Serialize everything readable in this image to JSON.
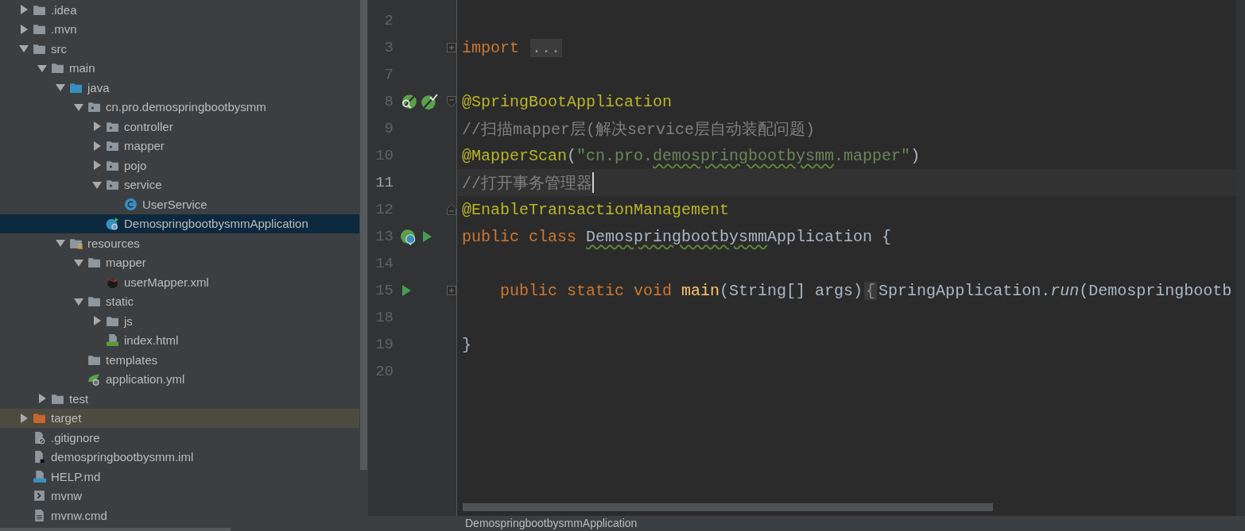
{
  "project_tree": [
    {
      "label": ".idea",
      "kind": "folder",
      "expanded": false,
      "selected": false,
      "highlighted": false
    },
    {
      "label": ".mvn",
      "kind": "folder",
      "expanded": false,
      "selected": false,
      "highlighted": false
    },
    {
      "label": "src",
      "kind": "folder",
      "expanded": true,
      "selected": false,
      "highlighted": false,
      "children": [
        {
          "label": "main",
          "kind": "folder",
          "expanded": true,
          "selected": false,
          "highlighted": false,
          "children": [
            {
              "label": "java",
              "kind": "sources",
              "expanded": true,
              "selected": false,
              "highlighted": false,
              "children": [
                {
                  "label": "cn.pro.demospringbootbysmm",
                  "kind": "package",
                  "expanded": true,
                  "selected": false,
                  "highlighted": false,
                  "children": [
                    {
                      "label": "controller",
                      "kind": "package",
                      "expanded": false,
                      "selected": false,
                      "highlighted": false
                    },
                    {
                      "label": "mapper",
                      "kind": "package",
                      "expanded": false,
                      "selected": false,
                      "highlighted": false
                    },
                    {
                      "label": "pojo",
                      "kind": "package",
                      "expanded": false,
                      "selected": false,
                      "highlighted": false
                    },
                    {
                      "label": "service",
                      "kind": "package",
                      "expanded": true,
                      "selected": false,
                      "highlighted": false,
                      "children": [
                        {
                          "label": "UserService",
                          "kind": "class",
                          "selected": false,
                          "highlighted": false
                        }
                      ]
                    },
                    {
                      "label": "DemospringbootbysmmApplication",
                      "kind": "application",
                      "selected": true,
                      "highlighted": false
                    }
                  ]
                }
              ]
            },
            {
              "label": "resources",
              "kind": "resources",
              "expanded": true,
              "selected": false,
              "highlighted": false,
              "children": [
                {
                  "label": "mapper",
                  "kind": "folder",
                  "expanded": true,
                  "selected": false,
                  "highlighted": false,
                  "children": [
                    {
                      "label": "userMapper.xml",
                      "kind": "mapping",
                      "selected": false,
                      "highlighted": false
                    }
                  ]
                },
                {
                  "label": "static",
                  "kind": "folder",
                  "expanded": true,
                  "selected": false,
                  "highlighted": false,
                  "children": [
                    {
                      "label": "js",
                      "kind": "folder",
                      "expanded": false,
                      "selected": false,
                      "highlighted": false
                    },
                    {
                      "label": "index.html",
                      "kind": "html",
                      "selected": false,
                      "highlighted": false
                    }
                  ]
                },
                {
                  "label": "templates",
                  "kind": "folder",
                  "selected": false,
                  "highlighted": false
                },
                {
                  "label": "application.yml",
                  "kind": "config",
                  "selected": false,
                  "highlighted": false
                }
              ]
            }
          ]
        },
        {
          "label": "test",
          "kind": "folder",
          "expanded": false,
          "selected": false,
          "highlighted": false
        }
      ]
    },
    {
      "label": "target",
      "kind": "excluded",
      "expanded": false,
      "selected": false,
      "highlighted": true
    },
    {
      "label": ".gitignore",
      "kind": "ignore",
      "selected": false,
      "highlighted": false
    },
    {
      "label": "demospringbootbysmm.iml",
      "kind": "module",
      "selected": false,
      "highlighted": false
    },
    {
      "label": "HELP.md",
      "kind": "markdown",
      "selected": false,
      "highlighted": false
    },
    {
      "label": "mvnw",
      "kind": "script",
      "selected": false,
      "highlighted": false
    },
    {
      "label": "mvnw.cmd",
      "kind": "text",
      "selected": false,
      "highlighted": false
    }
  ],
  "editor": {
    "lines": [
      {
        "number": "2",
        "kind": "plain",
        "current": false
      },
      {
        "number": "3",
        "kind": "imports",
        "current": false,
        "tokens": [
          {
            "kind": "keyword",
            "text": "import "
          },
          {
            "kind": "folded",
            "text": "..."
          }
        ]
      },
      {
        "number": "7",
        "kind": "plain",
        "current": false
      },
      {
        "number": "8",
        "kind": "springapp",
        "current": false,
        "tokens": [
          {
            "kind": "annotation",
            "text": "@SpringBootApplication"
          }
        ]
      },
      {
        "number": "9",
        "kind": "plain",
        "current": false,
        "tokens": [
          {
            "kind": "comment",
            "text": "//扫描mapper层(解决service层自动装配问题)"
          }
        ]
      },
      {
        "number": "10",
        "kind": "plain",
        "current": false,
        "tokens": [
          {
            "kind": "annotation",
            "text": "@MapperScan"
          },
          {
            "kind": "plain",
            "text": "("
          },
          {
            "kind": "string",
            "text": "\"cn.pro."
          },
          {
            "kind": "string-typo",
            "text": "demospringbootbysmm"
          },
          {
            "kind": "string",
            "text": ".mapper\""
          },
          {
            "kind": "plain",
            "text": ")"
          }
        ]
      },
      {
        "number": "11",
        "kind": "plain",
        "current": true,
        "tokens": [
          {
            "kind": "comment",
            "text": "//打开事务管理器"
          }
        ]
      },
      {
        "number": "12",
        "kind": "foldend",
        "current": false,
        "tokens": [
          {
            "kind": "annotation",
            "text": "@EnableTransactionManagement"
          }
        ]
      },
      {
        "number": "13",
        "kind": "mainclass",
        "current": false,
        "tokens": [
          {
            "kind": "keyword",
            "text": "public class "
          },
          {
            "kind": "plain-typo",
            "text": "Demospringbootbysmm"
          },
          {
            "kind": "plain",
            "text": "Application {"
          }
        ]
      },
      {
        "number": "14",
        "kind": "plain",
        "current": false
      },
      {
        "number": "15",
        "kind": "mainmethod",
        "current": false,
        "tokens": [
          {
            "kind": "keyword",
            "text": "    public static void "
          },
          {
            "kind": "method",
            "text": "main"
          },
          {
            "kind": "plain",
            "text": "(String[] args)"
          },
          {
            "kind": "folded",
            "text": "{"
          },
          {
            "kind": "plain",
            "text": "SpringApplication."
          },
          {
            "kind": "italic",
            "text": "run"
          },
          {
            "kind": "plain",
            "text": "(Demospringbootb"
          }
        ]
      },
      {
        "number": "18",
        "kind": "plain",
        "current": false
      },
      {
        "number": "19",
        "kind": "plain",
        "current": false,
        "tokens": [
          {
            "kind": "plain",
            "text": "}"
          }
        ]
      },
      {
        "number": "20",
        "kind": "plain",
        "current": false
      }
    ]
  },
  "status_bar": {
    "breadcrumb": "DemospringbootbysmmApplication"
  }
}
